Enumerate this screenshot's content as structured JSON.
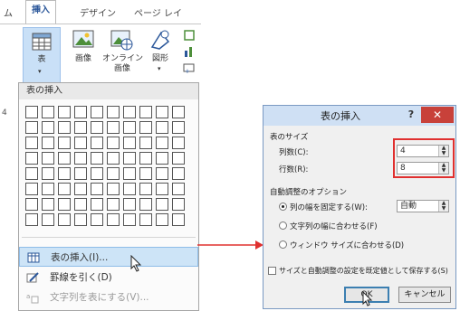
{
  "ribbon": {
    "tabs": [
      "ム",
      "挿入",
      "デザイン",
      "ページ レイ"
    ],
    "buttons": {
      "table": "表",
      "picture": "画像",
      "online_picture_line1": "オンライン",
      "online_picture_line2": "画像",
      "shapes": "図形"
    }
  },
  "menu": {
    "header": "表の挿入",
    "grid_cols": 10,
    "grid_rows": 8,
    "items": [
      {
        "label": "表の挿入(I)...",
        "highlighted": true,
        "enabled": true,
        "icon": "table-icon"
      },
      {
        "label": "罫線を引く(D)",
        "highlighted": false,
        "enabled": true,
        "icon": "pencil-icon"
      },
      {
        "label": "文字列を表にする(V)...",
        "highlighted": false,
        "enabled": false,
        "icon": "text-to-table-icon"
      }
    ],
    "left_marker": "4"
  },
  "dialog": {
    "title": "表の挿入",
    "help": "?",
    "close": "✕",
    "size_group": "表のサイズ",
    "columns_label": "列数(C):",
    "columns_value": "4",
    "rows_label": "行数(R):",
    "rows_value": "8",
    "autofit_group": "自動調整のオプション",
    "options": [
      {
        "label": "列の幅を固定する(W):",
        "selected": true
      },
      {
        "label": "文字列の幅に合わせる(F)",
        "selected": false
      },
      {
        "label": "ウィンドウ サイズに合わせる(D)",
        "selected": false
      }
    ],
    "fixed_width_value": "自動",
    "remember_label": "サイズと自動調整の設定を既定値として保存する(S)",
    "ok": "OK",
    "cancel": "キャンセル"
  },
  "colors": {
    "accent": "#2b579a",
    "highlight": "#cde4f7",
    "annotation_red": "#e0302f",
    "close_red": "#c8413a"
  }
}
